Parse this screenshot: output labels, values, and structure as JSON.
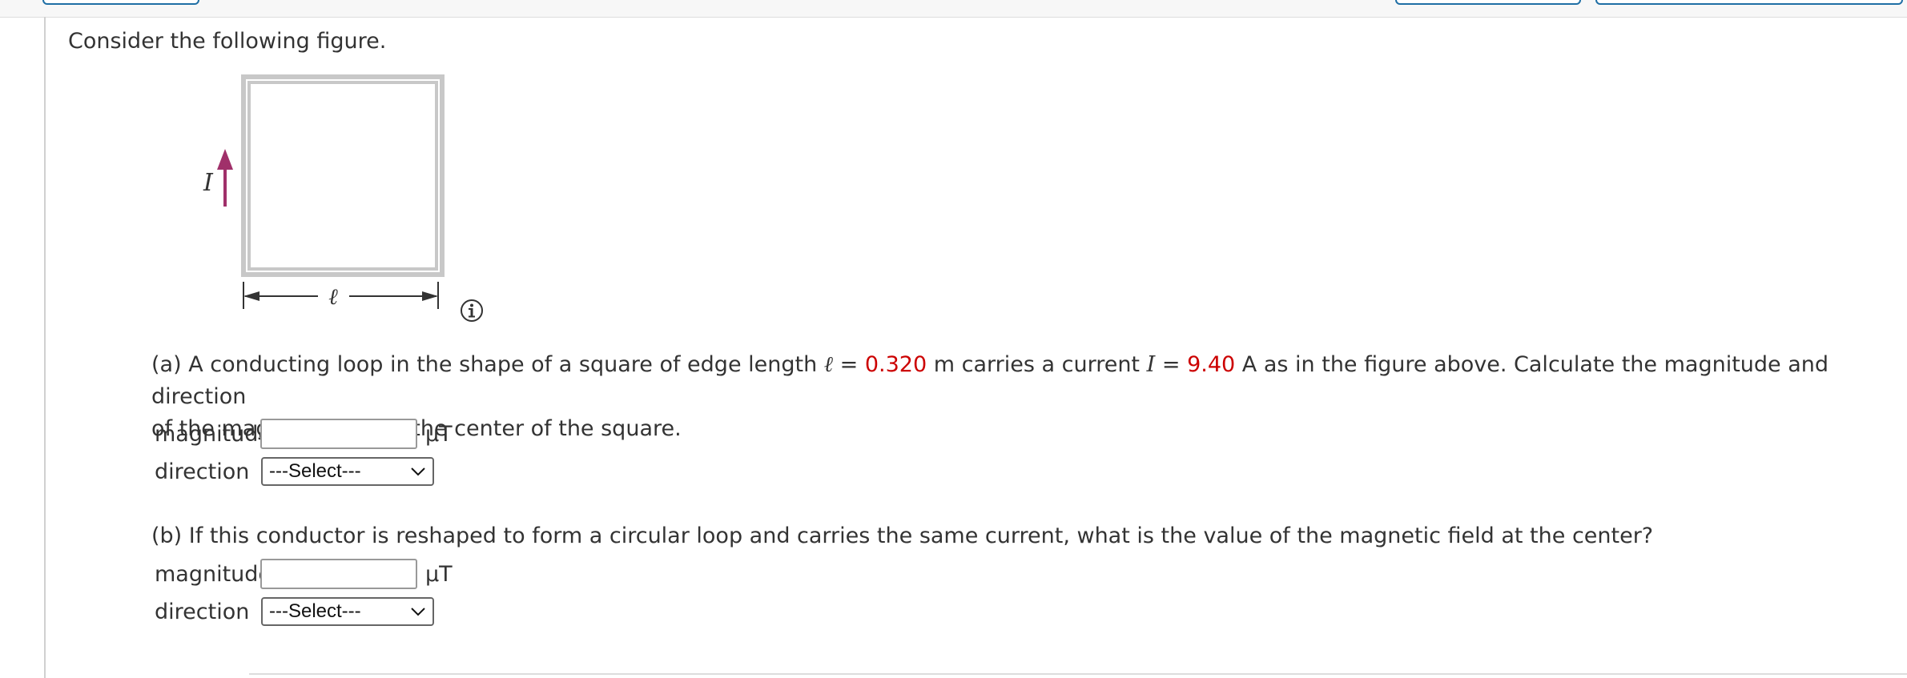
{
  "intro": "Consider the following figure.",
  "figure": {
    "current_symbol": "I",
    "length_symbol": "ℓ",
    "arrow_color": "#a0306a"
  },
  "part_a": {
    "prefix": "(a) A conducting loop in the shape of a square of edge length ",
    "ell": "ℓ",
    "eq1": " = ",
    "length_value": "0.320",
    "mid": " m carries a current ",
    "current_symbol": "I",
    "eq2": " = ",
    "current_value": "9.40",
    "suffix_line1": " A as in the figure above. Calculate the magnitude and direction",
    "line2": "of the magnetic field at the center of the square.",
    "magnitude_label": "magnitude",
    "magnitude_value": "",
    "unit": "μT",
    "direction_label": "direction",
    "direction_selected": "---Select---"
  },
  "part_b": {
    "text": "(b) If this conductor is reshaped to form a circular loop and carries the same current, what is the value of the magnetic field at the center?",
    "magnitude_label": "magnitude",
    "magnitude_value": "",
    "unit": "μT",
    "direction_label": "direction",
    "direction_selected": "---Select---"
  },
  "colors": {
    "given_value": "#cc0000",
    "text": "#333333"
  }
}
